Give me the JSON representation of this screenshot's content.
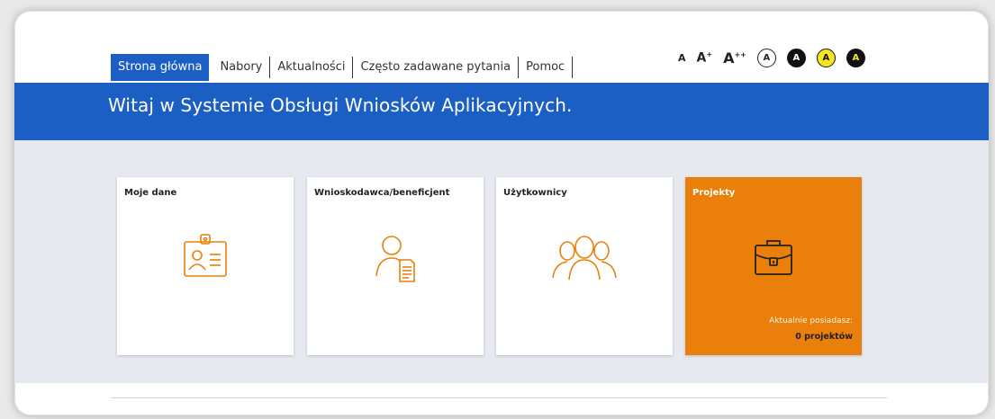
{
  "nav": {
    "items": [
      {
        "label": "Strona główna"
      },
      {
        "label": "Nabory"
      },
      {
        "label": "Aktualności"
      },
      {
        "label": "Często zadawane pytania"
      },
      {
        "label": "Pomoc"
      }
    ]
  },
  "accessibility": {
    "font_small": "A",
    "font_medium": "A",
    "font_medium_sup": "+",
    "font_large": "A",
    "font_large_sup": "++",
    "contrast_label": "A",
    "contrast_colors": [
      "#ffffff",
      "#111111",
      "#f5e61e",
      "#111111"
    ]
  },
  "banner": {
    "title": "Witaj w Systemie Obsługi Wniosków Aplikacyjnych."
  },
  "tiles": [
    {
      "title": "Moje dane",
      "icon": "id-card-icon"
    },
    {
      "title": "Wnioskodawca/beneficjent",
      "icon": "person-document-icon"
    },
    {
      "title": "Użytkownicy",
      "icon": "users-group-icon"
    },
    {
      "title": "Projekty",
      "icon": "briefcase-icon",
      "status_label": "Aktualnie posiadasz:",
      "status_value": "0 projektów"
    }
  ],
  "colors": {
    "primary": "#1c5fc4",
    "accent": "#ea7f0b"
  }
}
